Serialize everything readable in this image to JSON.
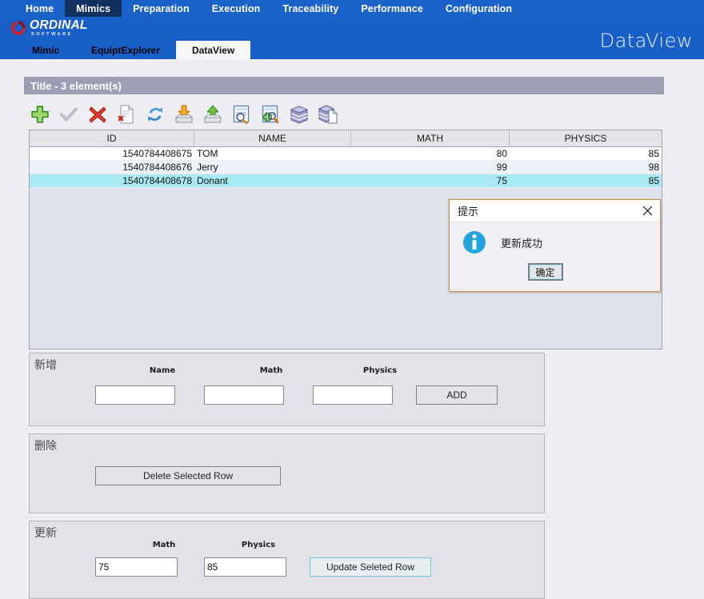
{
  "header": {
    "main_nav": [
      {
        "label": "Home",
        "active": false
      },
      {
        "label": "Mimics",
        "active": true
      },
      {
        "label": "Preparation",
        "active": false
      },
      {
        "label": "Execution",
        "active": false
      },
      {
        "label": "Traceability",
        "active": false
      },
      {
        "label": "Performance",
        "active": false
      },
      {
        "label": "Configuration",
        "active": false
      }
    ],
    "logo_name": "ORDINAL",
    "logo_sub": "SOFTWARE",
    "app_title": "DataView",
    "brand_color": "#1860c8",
    "active_nav_color": "#11305e"
  },
  "sub_tabs": [
    {
      "label": "Mimic",
      "active": false
    },
    {
      "label": "EquiptExplorer",
      "active": false
    },
    {
      "label": "DataView",
      "active": true
    }
  ],
  "panel": {
    "title": "Title - 3 element(s)"
  },
  "toolbar": {
    "items": [
      {
        "icon": "add-plus-icon",
        "name": "add-row-button"
      },
      {
        "icon": "check-icon",
        "name": "commit-button"
      },
      {
        "icon": "delete-cross-icon",
        "name": "delete-row-button"
      },
      {
        "icon": "page-delete-icon",
        "name": "delete-page-button"
      },
      {
        "icon": "refresh-icon",
        "name": "refresh-button"
      },
      {
        "icon": "import-down-icon",
        "name": "import-button"
      },
      {
        "icon": "export-up-icon",
        "name": "export-button"
      },
      {
        "icon": "search-document-icon",
        "name": "find-button"
      },
      {
        "icon": "search-web-document-icon",
        "name": "find-web-button"
      },
      {
        "icon": "database-icon",
        "name": "database-button"
      },
      {
        "icon": "database-page-icon",
        "name": "database-page-button"
      }
    ]
  },
  "table": {
    "columns": [
      "ID",
      "NAME",
      "MATH",
      "PHYSICS"
    ],
    "rows": [
      {
        "id": "1540784408675",
        "name": "TOM",
        "math": "80",
        "physics": "85",
        "selected": false
      },
      {
        "id": "1540784408676",
        "name": "Jerry",
        "math": "99",
        "physics": "98",
        "selected": false
      },
      {
        "id": "1540784408678",
        "name": "Donant",
        "math": "75",
        "physics": "85",
        "selected": true
      }
    ],
    "selected_row_color": "#a8e9f2"
  },
  "add_section": {
    "legend": "新增",
    "name_label": "Name",
    "math_label": "Math",
    "physics_label": "Physics",
    "name_value": "",
    "math_value": "",
    "physics_value": "",
    "button_label": "ADD"
  },
  "delete_section": {
    "legend": "删除",
    "button_label": "Delete Selected Row"
  },
  "update_section": {
    "legend": "更新",
    "math_label": "Math",
    "physics_label": "Physics",
    "math_value": "75",
    "physics_value": "85",
    "button_label": "Update Seleted Row"
  },
  "dialog": {
    "title": "提示",
    "message": "更新成功",
    "ok_label": "确定",
    "close_icon": "close-x-icon",
    "info_icon": "info-circle-icon",
    "border_color": "#d08a43",
    "icon_color": "#21a4dd"
  }
}
